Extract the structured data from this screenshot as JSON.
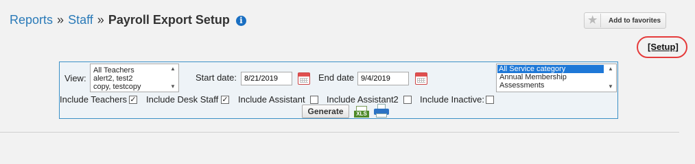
{
  "breadcrumb": {
    "items": [
      "Reports",
      "Staff"
    ],
    "separator": "»",
    "current": "Payroll Export Setup"
  },
  "info_icon": "i",
  "favorites_button": {
    "label": "Add to favorites",
    "icon": "★"
  },
  "setup_link": "[Setup]",
  "filters": {
    "view_label": "View:",
    "view_options": [
      "All Teachers",
      "alert2, test2",
      "copy, testcopy"
    ],
    "start_date_label": "Start date:",
    "start_date_value": "8/21/2019",
    "end_date_label": "End date",
    "end_date_value": "9/4/2019",
    "service_options": [
      "All Service category",
      "Annual Membership",
      "Assessments"
    ],
    "service_selected": "All Service category",
    "checkboxes": [
      {
        "label": "Include Teachers",
        "checked": true
      },
      {
        "label": "Include Desk Staff",
        "checked": true
      },
      {
        "label": "Include Assistant",
        "checked": false
      },
      {
        "label": "Include Assistant2",
        "checked": false
      },
      {
        "label": "Include Inactive:",
        "checked": false
      }
    ],
    "generate_label": "Generate",
    "xls_label": "XLS"
  },
  "colors": {
    "link": "#2a7ab8",
    "panel_border": "#3a8fc6",
    "highlight": "#e53a3a",
    "selection": "#1e78d7"
  }
}
